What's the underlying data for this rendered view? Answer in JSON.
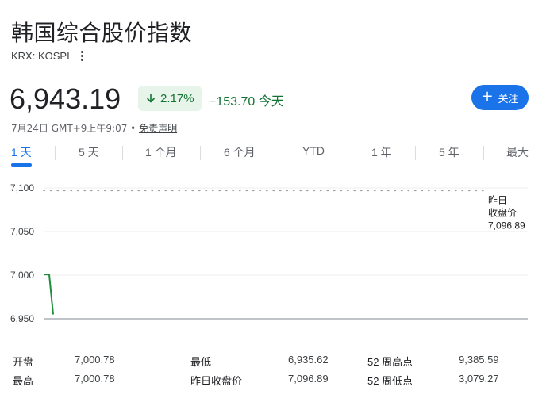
{
  "header": {
    "title": "韩国综合股价指数",
    "ticker": "KRX: KOSPI"
  },
  "quote": {
    "price": "6,943.19",
    "change_pct": "2.17%",
    "change_abs": "−153.70 今天",
    "direction": "down",
    "timestamp": "7月24日 GMT+9上午9:07",
    "separator": "•",
    "disclaimer": "免责声明",
    "follow_label": "关注"
  },
  "tabs": [
    {
      "label": "1 天",
      "active": true
    },
    {
      "label": "5 天",
      "active": false
    },
    {
      "label": "1 个月",
      "active": false
    },
    {
      "label": "6 个月",
      "active": false
    },
    {
      "label": "YTD",
      "active": false
    },
    {
      "label": "1 年",
      "active": false
    },
    {
      "label": "5 年",
      "active": false
    },
    {
      "label": "最大",
      "active": false
    }
  ],
  "chart_data": {
    "type": "line",
    "y_ticks": [
      "7,100",
      "7,050",
      "7,000",
      "6,950"
    ],
    "ylim": [
      6950,
      7100
    ],
    "previous_close": 7096.89,
    "previous_close_label": [
      "昨日",
      "收盘价",
      "7,096.89"
    ],
    "series": [
      {
        "values": [
          7000.78,
          7000.78,
          6955
        ]
      }
    ],
    "line_color": "#1e8e3e",
    "grid": true
  },
  "stats": [
    {
      "label": "开盘",
      "value": "7,000.78"
    },
    {
      "label": "最低",
      "value": "6,935.62"
    },
    {
      "label": "52 周高点",
      "value": "9,385.59"
    },
    {
      "label": "最高",
      "value": "7,000.78"
    },
    {
      "label": "昨日收盘价",
      "value": "7,096.89"
    },
    {
      "label": "52 周低点",
      "value": "3,079.27"
    }
  ],
  "colors": {
    "accent": "#1a73e8",
    "positive_bg": "#e6f4ea",
    "change_text": "#137333"
  }
}
